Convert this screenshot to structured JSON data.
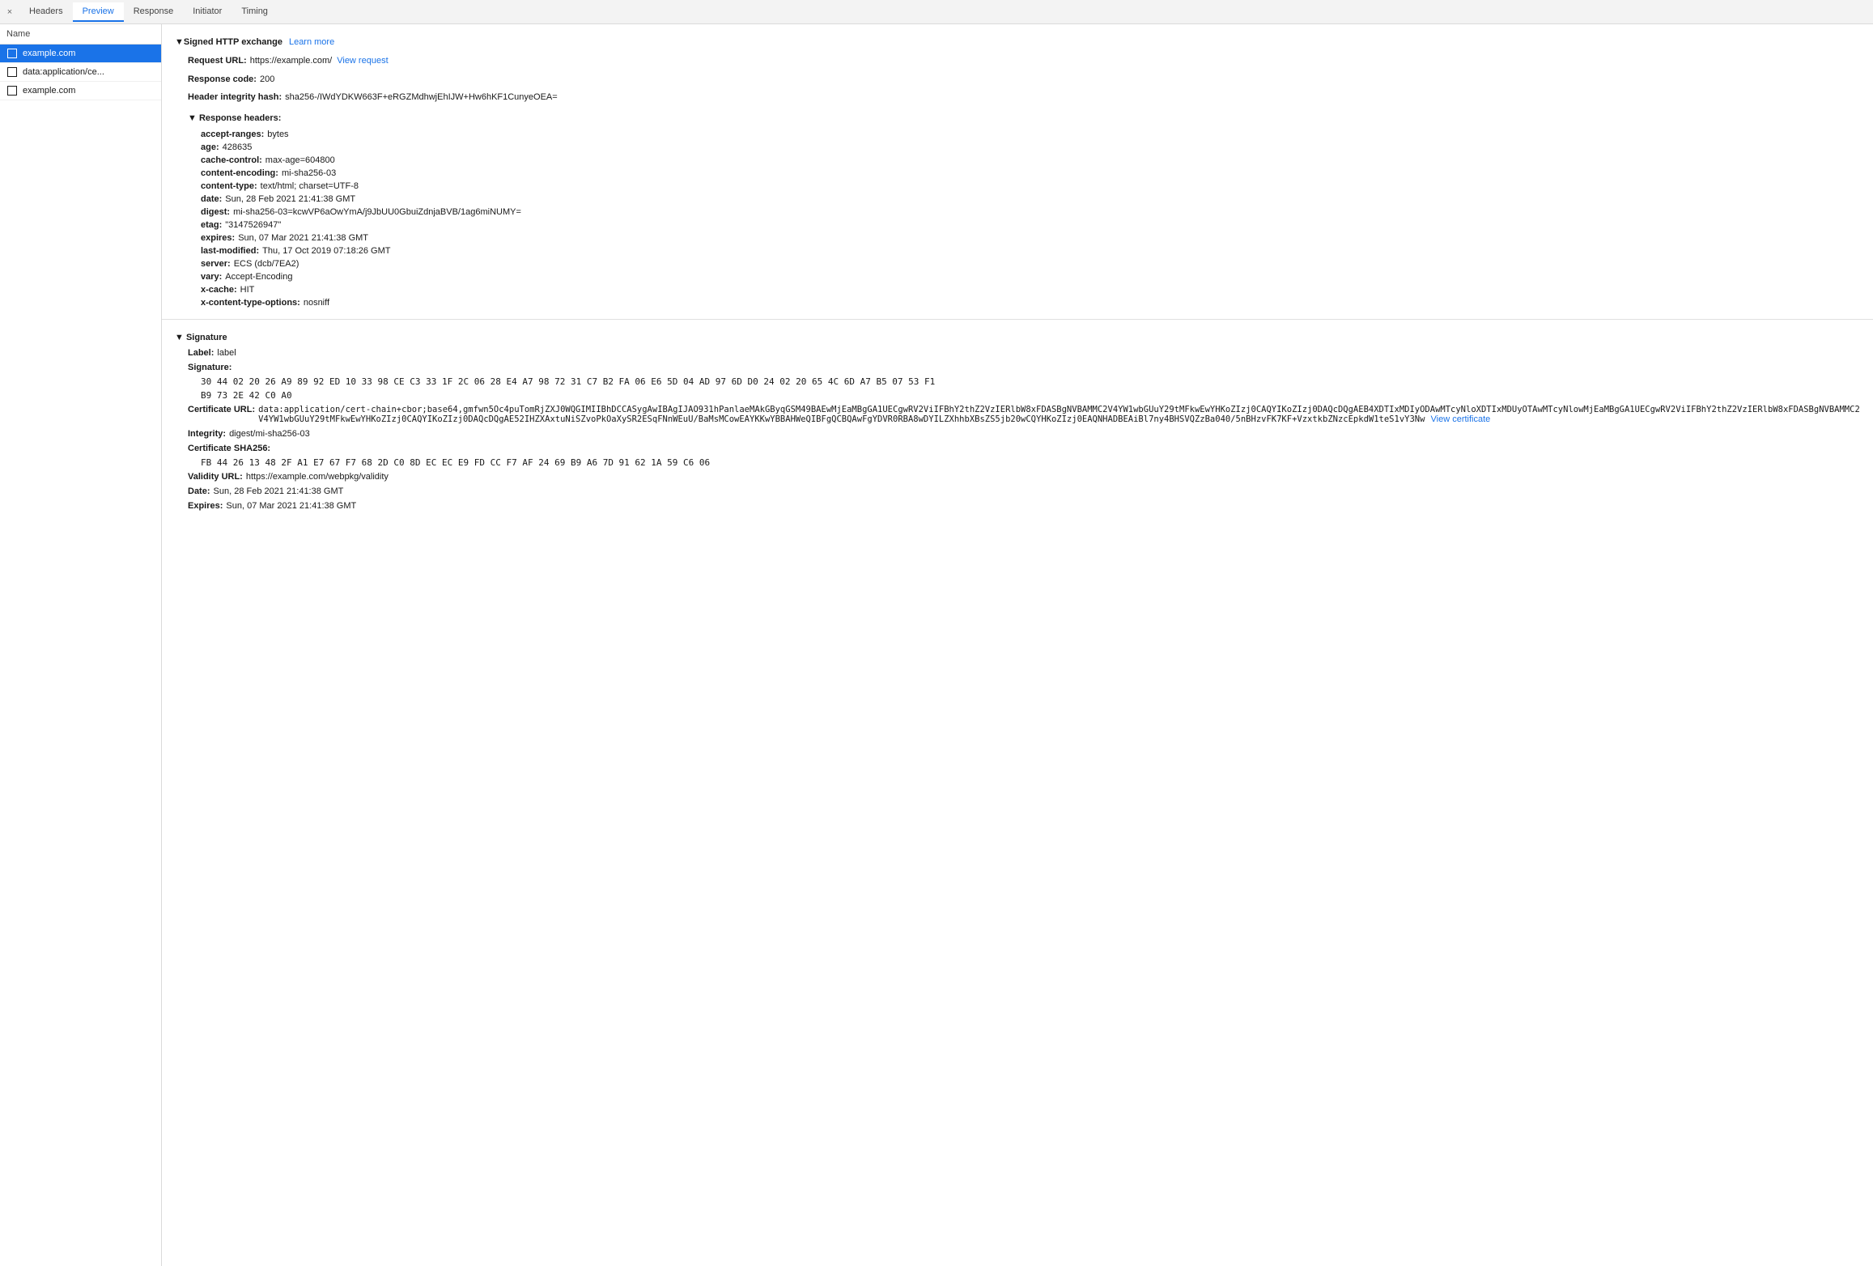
{
  "tabs": {
    "close_icon": "×",
    "items": [
      {
        "id": "name",
        "label": "Name",
        "active": false
      },
      {
        "id": "headers",
        "label": "Headers",
        "active": false
      },
      {
        "id": "preview",
        "label": "Preview",
        "active": true
      },
      {
        "id": "response",
        "label": "Response",
        "active": false
      },
      {
        "id": "initiator",
        "label": "Initiator",
        "active": false
      },
      {
        "id": "timing",
        "label": "Timing",
        "active": false
      }
    ]
  },
  "sidebar": {
    "header": "Name",
    "items": [
      {
        "id": "example-com",
        "label": "example.com",
        "selected": true
      },
      {
        "id": "data-application",
        "label": "data:application/ce...",
        "selected": false
      },
      {
        "id": "example-com-2",
        "label": "example.com",
        "selected": false
      }
    ]
  },
  "signed_http_exchange": {
    "section_title": "▼ Signed HTTP exchange",
    "learn_more": "Learn more",
    "request_url_label": "Request URL:",
    "request_url_value": "https://example.com/",
    "view_request_label": "View request",
    "response_code_label": "Response code:",
    "response_code_value": "200",
    "header_integrity_label": "Header integrity hash:",
    "header_integrity_value": "sha256-/IWdYDKW663F+eRGZMdhwjEhIJW+Hw6hKF1CunyeOEA=",
    "response_headers_label": "▼ Response headers:",
    "headers": [
      {
        "name": "accept-ranges:",
        "value": "bytes"
      },
      {
        "name": "age:",
        "value": "428635"
      },
      {
        "name": "cache-control:",
        "value": "max-age=604800"
      },
      {
        "name": "content-encoding:",
        "value": "mi-sha256-03"
      },
      {
        "name": "content-type:",
        "value": "text/html; charset=UTF-8"
      },
      {
        "name": "date:",
        "value": "Sun, 28 Feb 2021 21:41:38 GMT"
      },
      {
        "name": "digest:",
        "value": "mi-sha256-03=kcwVP6aOwYmA/j9JbUU0GbuiZdnjaBVB/1ag6miNUMY="
      },
      {
        "name": "etag:",
        "value": "\"3147526947\""
      },
      {
        "name": "expires:",
        "value": "Sun, 07 Mar 2021 21:41:38 GMT"
      },
      {
        "name": "last-modified:",
        "value": "Thu, 17 Oct 2019 07:18:26 GMT"
      },
      {
        "name": "server:",
        "value": "ECS (dcb/7EA2)"
      },
      {
        "name": "vary:",
        "value": "Accept-Encoding"
      },
      {
        "name": "x-cache:",
        "value": "HIT"
      },
      {
        "name": "x-content-type-options:",
        "value": "nosniff"
      }
    ]
  },
  "signature": {
    "section_title": "▼ Signature",
    "label_label": "Label:",
    "label_value": "label",
    "signature_label": "Signature:",
    "signature_line1": "30 44 02 20 26 A9 89 92 ED 10 33 98 CE C3 33 1F 2C 06 28 E4 A7 98 72 31 C7 B2 FA 06 E6 5D 04 AD 97 6D D0 24 02 20 65 4C 6D A7 B5 07 53 F1",
    "signature_line2": "B9 73 2E 42 C0 A0",
    "certificate_url_label": "Certificate URL:",
    "certificate_url_value": "data:application/cert-chain+cbor;base64,gmfwn5Oc4puTomRjZXJ0WQGIMIIBhDCCASygAwIBAgIJAO931hPanlaeMAkGByqGSM49BAEwMjEaMBgGA1UECgwRV2ViIFBhY2thZ2VzIERlbW8xFDASBgNVBAMMC2V4YW1wbGUuY29tMFkwEwYHKoZIzj0CAQYIKoZIzj0DAQcDQgAEB4XDTIxMDIyODAwMTcyNloXDTIxMDUyOTAwMTcyNlowMjEaMBgGA1UECgwRV2ViIFBhY2thZ2VzIERlbW8xFDASBgNVBAMMC2V4YW1wbGUuY29tMFkwEwYHKoZIzj0CAQYIKoZIzj0DAQcDQgAE52IHZXAxtuNiSZvoPkOaXySR2ESqFNnWEuU/BaMsMCowEAYKKwYBBAHWeQIBFgQCBQAwFgYDVR0RBA8wDYILZXhhbXBsZS5jb20wCQYHKoZIzj0EAQNHADBEAiBl7ny4BHSVQZzBa040/5nBHzvFK7KF+VzxtkbZNzcEpkdW1teS1vY3Nw",
    "view_certificate_label": "View certificate",
    "integrity_label": "Integrity:",
    "integrity_value": "digest/mi-sha256-03",
    "cert_sha256_label": "Certificate SHA256:",
    "cert_sha256_value": "FB 44 26 13 48 2F A1 E7 67 F7 68 2D C0 8D EC EC E9 FD CC F7 AF 24 69 B9 A6 7D 91 62 1A 59 C6 06",
    "validity_url_label": "Validity URL:",
    "validity_url_value": "https://example.com/webpkg/validity",
    "date_label": "Date:",
    "date_value": "Sun, 28 Feb 2021 21:41:38 GMT",
    "expires_label": "Expires:",
    "expires_value": "Sun, 07 Mar 2021 21:41:38 GMT"
  }
}
